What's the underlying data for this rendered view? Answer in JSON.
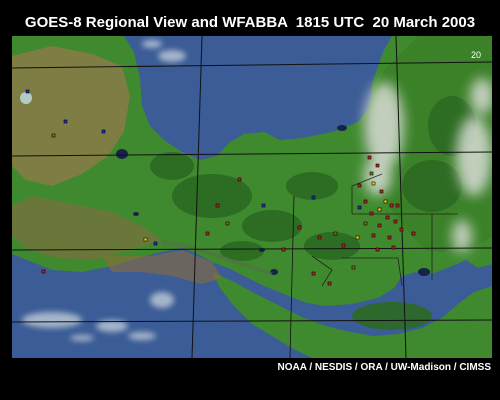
{
  "title": "GOES-8 Regional View and WFABBA  1815 UTC  20 March 2003",
  "frame_number": "20",
  "credit": "NOAA / NESDIS / ORA / UW-Madison / CIMSS",
  "colors": {
    "ocean": "#3b5c96",
    "land_green": "#3f8a2e",
    "land_dark": "#2c6a22",
    "land_brown": "#8a7a48",
    "cloud": "#d9dcd6",
    "grid": "#1a1a1a",
    "fire_red": "#c0281e",
    "fire_yellow": "#e8e020",
    "fire_blue": "#2030c0",
    "fire_olive": "#7a7a20"
  }
}
